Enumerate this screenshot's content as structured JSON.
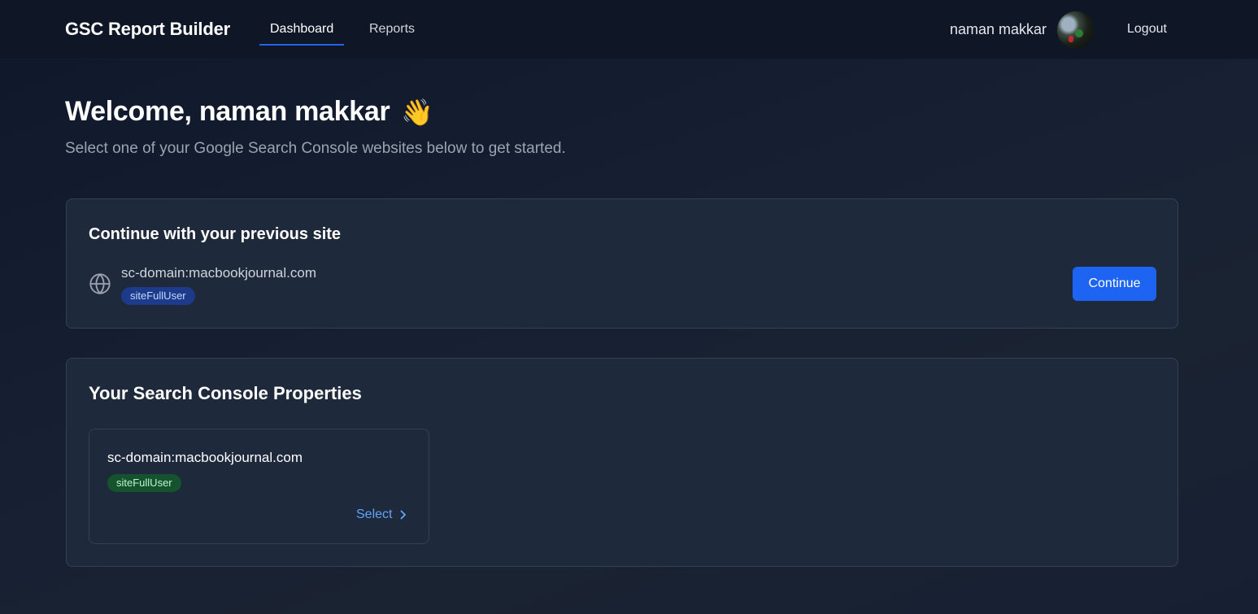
{
  "header": {
    "brand": "GSC Report Builder",
    "nav": [
      {
        "label": "Dashboard",
        "active": true
      },
      {
        "label": "Reports",
        "active": false
      }
    ],
    "user_name": "naman makkar",
    "logout_label": "Logout"
  },
  "welcome": {
    "title": "Welcome, naman makkar",
    "emoji": "👋",
    "subtitle": "Select one of your Google Search Console websites below to get started."
  },
  "previous_site": {
    "title": "Continue with your previous site",
    "domain": "sc-domain:macbookjournal.com",
    "permission": "siteFullUser",
    "button_label": "Continue",
    "icon": "globe-icon"
  },
  "properties": {
    "title": "Your Search Console Properties",
    "items": [
      {
        "domain": "sc-domain:macbookjournal.com",
        "permission": "siteFullUser",
        "action_label": "Select"
      }
    ]
  },
  "colors": {
    "accent": "#2563eb",
    "button": "#1d64f2",
    "link": "#60a5fa",
    "badge_blue": "#1e3a8a",
    "badge_green": "#14532d"
  }
}
